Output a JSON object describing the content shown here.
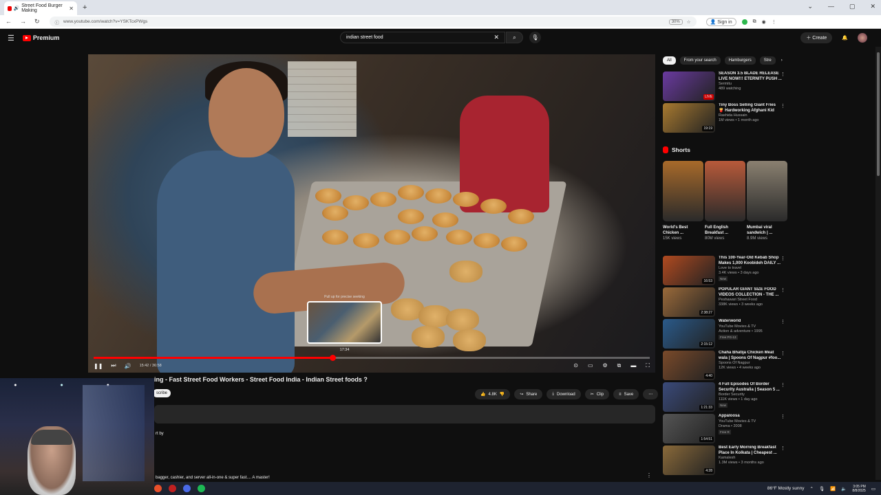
{
  "browser": {
    "tab_title": "Street Food Burger Making",
    "url": "www.youtube.com/watch?v=YSKTcxPWgs",
    "zoom": "30%",
    "signin": "Sign in"
  },
  "yt": {
    "brand": "Premium",
    "search_value": "indian street food",
    "create_label": "Create"
  },
  "player": {
    "preview_hint": "Pull up for precise seeking",
    "preview_time": "17:34",
    "time_display": "15:42 / 36:58",
    "progress_fraction": 0.43
  },
  "video": {
    "title": "ing - Fast Street Food Workers - Street Food India - Indian Street foods ?",
    "subscribe": "scribe",
    "likes": "4.8K",
    "share": "Share",
    "download": "Download",
    "clip": "Clip",
    "save": "Save",
    "sort_by": "rt by",
    "comment_text": "bagger, cashier, and server all-in-one & super fast.... A master!"
  },
  "chips": [
    "All",
    "From your search",
    "Hamburgers",
    "Stre"
  ],
  "sidebar_top": [
    {
      "title": "SEASON 3.5 BLADE RELEASE LIVE NOW!!! ETERNITY PUSH ...",
      "channel": "Sermitu",
      "meta": "489 watching",
      "dur": "LIVE",
      "color": "#6a3aa0"
    },
    {
      "title": "Tiny Boss Selling Giant Fries 🍟 Hardworking Afghani Kid Selli...",
      "channel": "Rashida Hussain",
      "meta": "1M views • 1 month ago",
      "dur": "19:19",
      "color": "#a87a30"
    }
  ],
  "shorts_label": "Shorts",
  "shorts": [
    {
      "title": "World's Best Chicken ...",
      "views": "15K views",
      "color": "#a86a2a"
    },
    {
      "title": "Full English Breakfast ...",
      "views": "80M views",
      "color": "#b85a3a"
    },
    {
      "title": "Mumbai viral sandwich | ...",
      "views": "8.9M views",
      "color": "#8a8070"
    }
  ],
  "sidebar_list": [
    {
      "title": "This 100-Year-Old Kebab Shop Makes 1,000 Koobideh DAILY ...",
      "channel": "Love to travel",
      "meta": "3.4K views • 3 days ago",
      "badge": "New",
      "dur": "16:53",
      "color": "#b04a20"
    },
    {
      "title": "POPULAR GIANT SIZE FOOD VIDEOS COLLECTION - THE ...",
      "channel": "Peshawari Street Food",
      "meta": "338K views • 3 weeks ago",
      "badge": "",
      "dur": "2:38:27",
      "color": "#9a6a3a"
    },
    {
      "title": "Waterworld",
      "channel": "YouTube Movies & TV",
      "meta": "Action & adventure • 1995",
      "badge": "Free PG-13",
      "dur": "2:15:12",
      "color": "#2a5a8a"
    },
    {
      "title": "Chaha Bhatija Chicken Meat wala | Spoons Of Nagpur #foo...",
      "channel": "Spoons Of Nagpur",
      "meta": "12K views • 4 weeks ago",
      "badge": "",
      "dur": "4:40",
      "color": "#7a4a2a"
    },
    {
      "title": "4 Full Episodes Of Border Security Australia | Season 5 ...",
      "channel": "Border Security",
      "meta": "111K views • 1 day ago",
      "badge": "New",
      "dur": "1:21:33",
      "color": "#3a4a7a"
    },
    {
      "title": "Appaloosa",
      "channel": "YouTube Movies & TV",
      "meta": "Drama • 2008",
      "badge": "Free R",
      "dur": "1:54:51",
      "color": "#555555"
    },
    {
      "title": "Best Early Morning Breakfast Place In Kolkata | Cheapest ...",
      "channel": "Kamalesh",
      "meta": "1.3M views • 3 months ago",
      "badge": "",
      "dur": "4:28",
      "color": "#8a6a3a"
    }
  ],
  "taskbar": {
    "weather": "86°F  Mostly sunny",
    "time": "3:05 PM",
    "date": "8/8/2025"
  }
}
